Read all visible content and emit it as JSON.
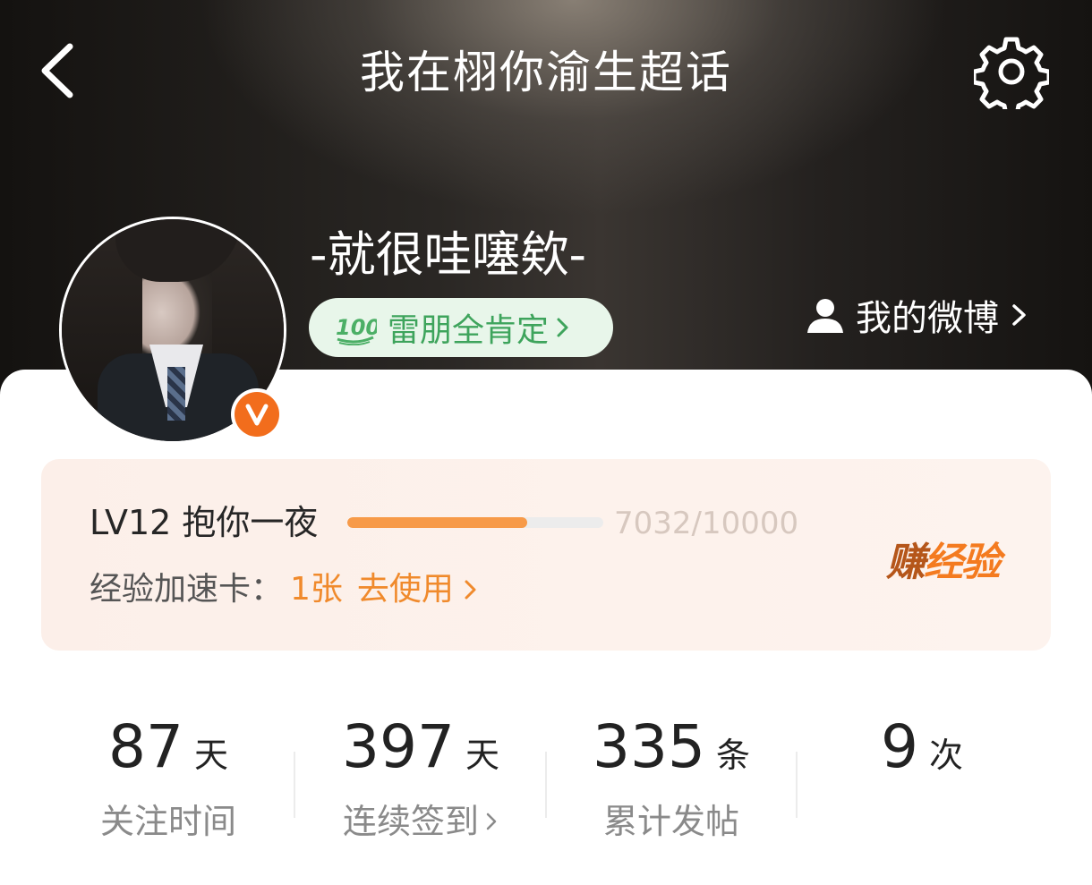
{
  "header": {
    "title": "我在栩你渝生超话",
    "back_icon": "back-arrow-icon",
    "settings_icon": "gear-icon"
  },
  "profile": {
    "name": "-就很哇噻欸-",
    "medal_label": "雷朋全肯定",
    "medal_icon": "hundred-points-icon",
    "my_weibo_label": "我的微博",
    "vip_badge": "V"
  },
  "level": {
    "label": "LV12 抱你一夜",
    "progress_fraction": 0.7032,
    "exp_text": "7032/10000",
    "boost_card_label": "经验加速卡：",
    "boost_card_count": "1张",
    "boost_card_action": "去使用",
    "earn_exp_part1": "赚",
    "earn_exp_part2": "经验"
  },
  "stats": [
    {
      "value": "87",
      "unit": "天",
      "label": "关注时间"
    },
    {
      "value": "397",
      "unit": "天",
      "label": "连续签到"
    },
    {
      "value": "335",
      "unit": "条",
      "label": "累计发帖"
    },
    {
      "value": "9",
      "unit": "次",
      "label": ""
    }
  ],
  "colors": {
    "accent_orange": "#f08a2c",
    "progress_fill": "#f79a48",
    "medal_green": "#3ea45c",
    "vip_orange": "#f26d1c"
  }
}
